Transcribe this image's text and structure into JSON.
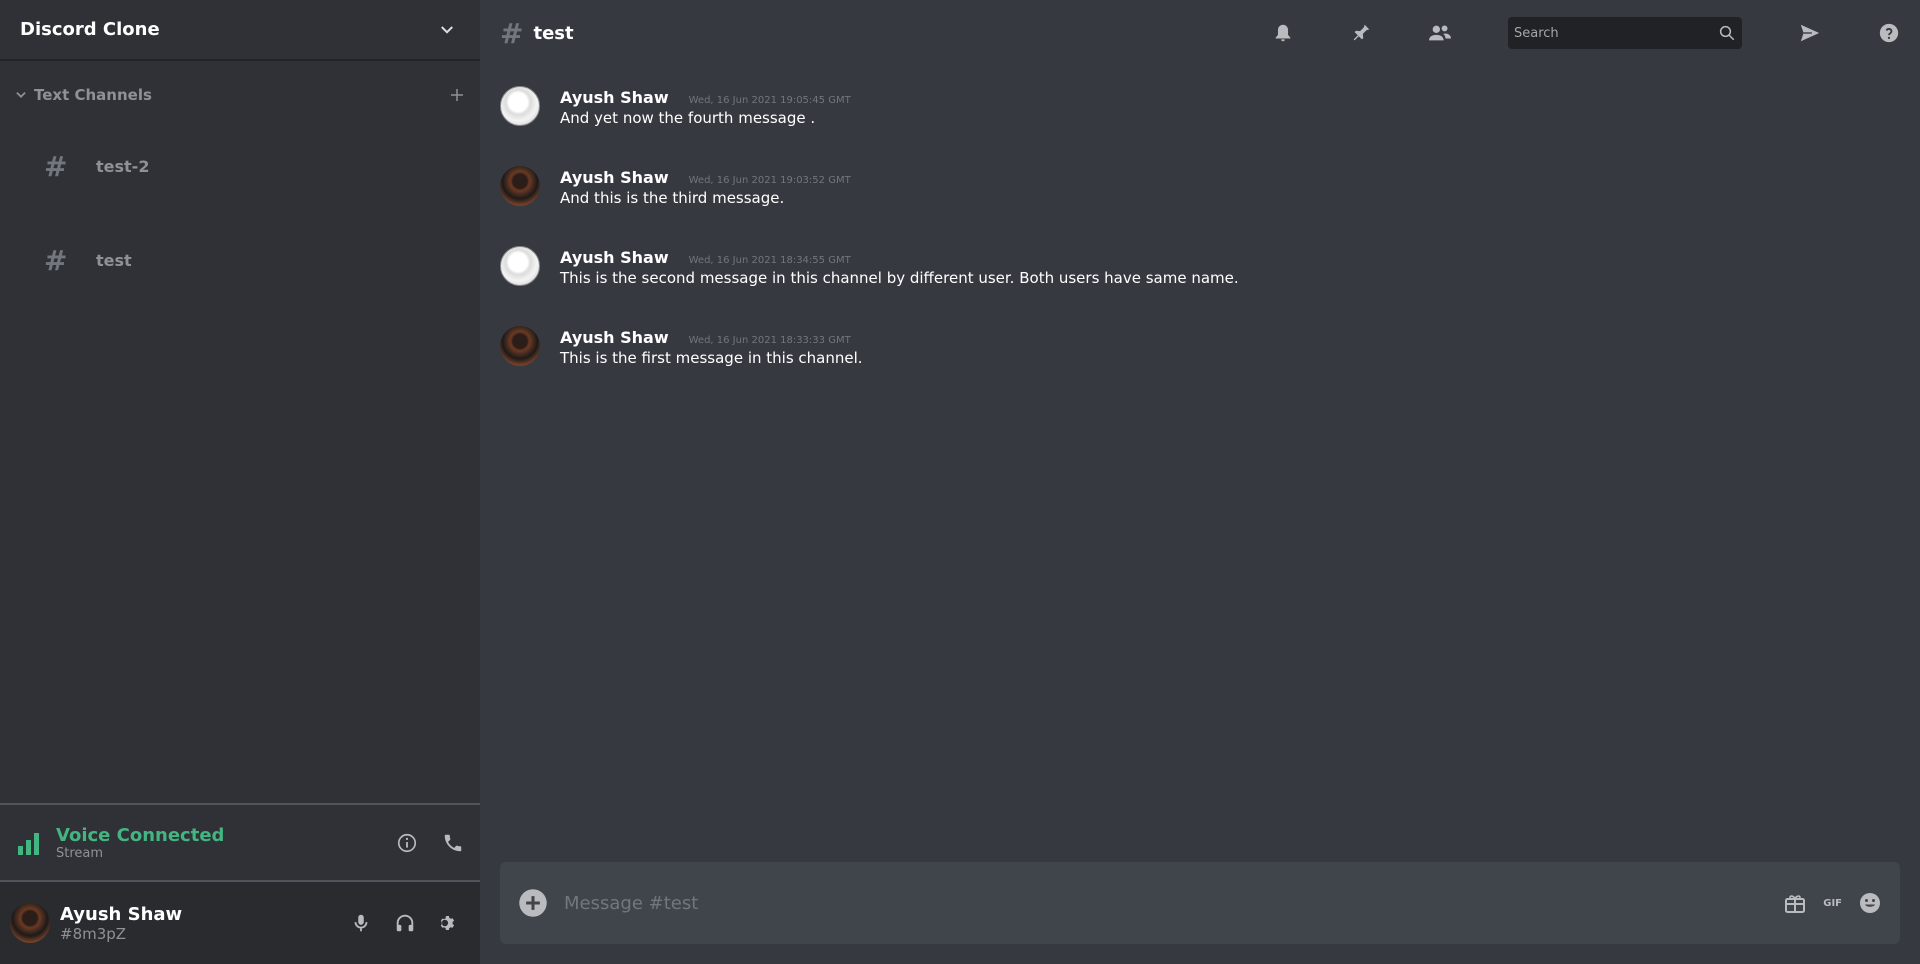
{
  "server": {
    "name": "Discord Clone"
  },
  "channels": {
    "header": "Text Channels",
    "items": [
      {
        "name": "test-2"
      },
      {
        "name": "test"
      }
    ]
  },
  "voice": {
    "title": "Voice Connected",
    "subtitle": "Stream"
  },
  "user": {
    "name": "Ayush Shaw",
    "tag": "#8m3pZ"
  },
  "channel_title": "test",
  "search": {
    "placeholder": "Search"
  },
  "messages": [
    {
      "author": "Ayush Shaw",
      "time": "Wed, 16 Jun 2021 19:05:45 GMT",
      "text": "And yet now the fourth message .",
      "avatar": "sketch"
    },
    {
      "author": "Ayush Shaw",
      "time": "Wed, 16 Jun 2021 19:03:52 GMT",
      "text": "And this is the third message.",
      "avatar": "photo"
    },
    {
      "author": "Ayush Shaw",
      "time": "Wed, 16 Jun 2021 18:34:55 GMT",
      "text": "This is the second message in this channel by different user. Both users have same name.",
      "avatar": "sketch"
    },
    {
      "author": "Ayush Shaw",
      "time": "Wed, 16 Jun 2021 18:33:33 GMT",
      "text": "This is the first message in this channel.",
      "avatar": "photo"
    }
  ],
  "composer": {
    "placeholder": "Message #test",
    "gif_label": "GIF"
  },
  "colors": {
    "accent_green": "#43b581",
    "sidebar_bg": "#2f3136",
    "main_bg": "#36393f"
  }
}
